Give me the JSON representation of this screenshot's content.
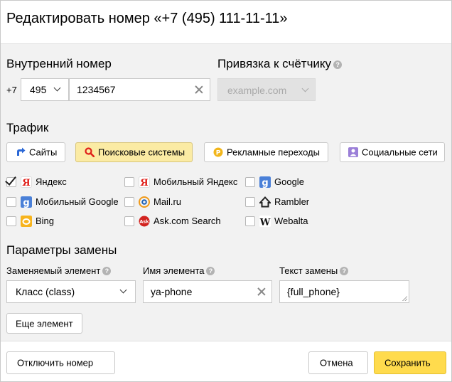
{
  "dialog": {
    "title": "Редактировать номер «+7 (495) 111-11-11»"
  },
  "internal_number": {
    "heading": "Внутренний номер",
    "country_prefix": "+7",
    "area_code": "495",
    "number": "1234567"
  },
  "counter_binding": {
    "heading": "Привязка к счётчику",
    "placeholder": "example.com"
  },
  "traffic": {
    "heading": "Трафик",
    "tabs": [
      {
        "label": "Сайты",
        "icon": "arrow-icon",
        "active": false
      },
      {
        "label": "Поисковые системы",
        "icon": "search-icon",
        "active": true
      },
      {
        "label": "Рекламные переходы",
        "icon": "coin-icon",
        "active": false
      },
      {
        "label": "Социальные сети",
        "icon": "person-icon",
        "active": false
      }
    ],
    "engines": [
      {
        "name": "Яндекс",
        "checked": true,
        "icon": "yandex-icon"
      },
      {
        "name": "Мобильный Яндекс",
        "checked": false,
        "icon": "yandex-icon"
      },
      {
        "name": "Google",
        "checked": false,
        "icon": "google-icon"
      },
      {
        "name": "Мобильный Google",
        "checked": false,
        "icon": "google-icon"
      },
      {
        "name": "Mail.ru",
        "checked": false,
        "icon": "mailru-icon"
      },
      {
        "name": "Rambler",
        "checked": false,
        "icon": "rambler-icon"
      },
      {
        "name": "Bing",
        "checked": false,
        "icon": "bing-icon"
      },
      {
        "name": "Ask.com Search",
        "checked": false,
        "icon": "ask-icon"
      },
      {
        "name": "Webalta",
        "checked": false,
        "icon": "webalta-icon"
      }
    ]
  },
  "replacement": {
    "heading": "Параметры замены",
    "element_label": "Заменяемый элемент",
    "element_value": "Класс (class)",
    "name_label": "Имя элемента",
    "name_value": "ya-phone",
    "text_label": "Текст замены",
    "text_value": "{full_phone}",
    "add_button": "Еще элемент"
  },
  "footer": {
    "disable_button": "Отключить номер",
    "cancel_button": "Отмена",
    "save_button": "Сохранить"
  },
  "colors": {
    "save_yellow": "#ffdb4d",
    "active_tab": "#fbeba4",
    "panel_bg": "#f2f2f2"
  },
  "help_glyph": "?"
}
